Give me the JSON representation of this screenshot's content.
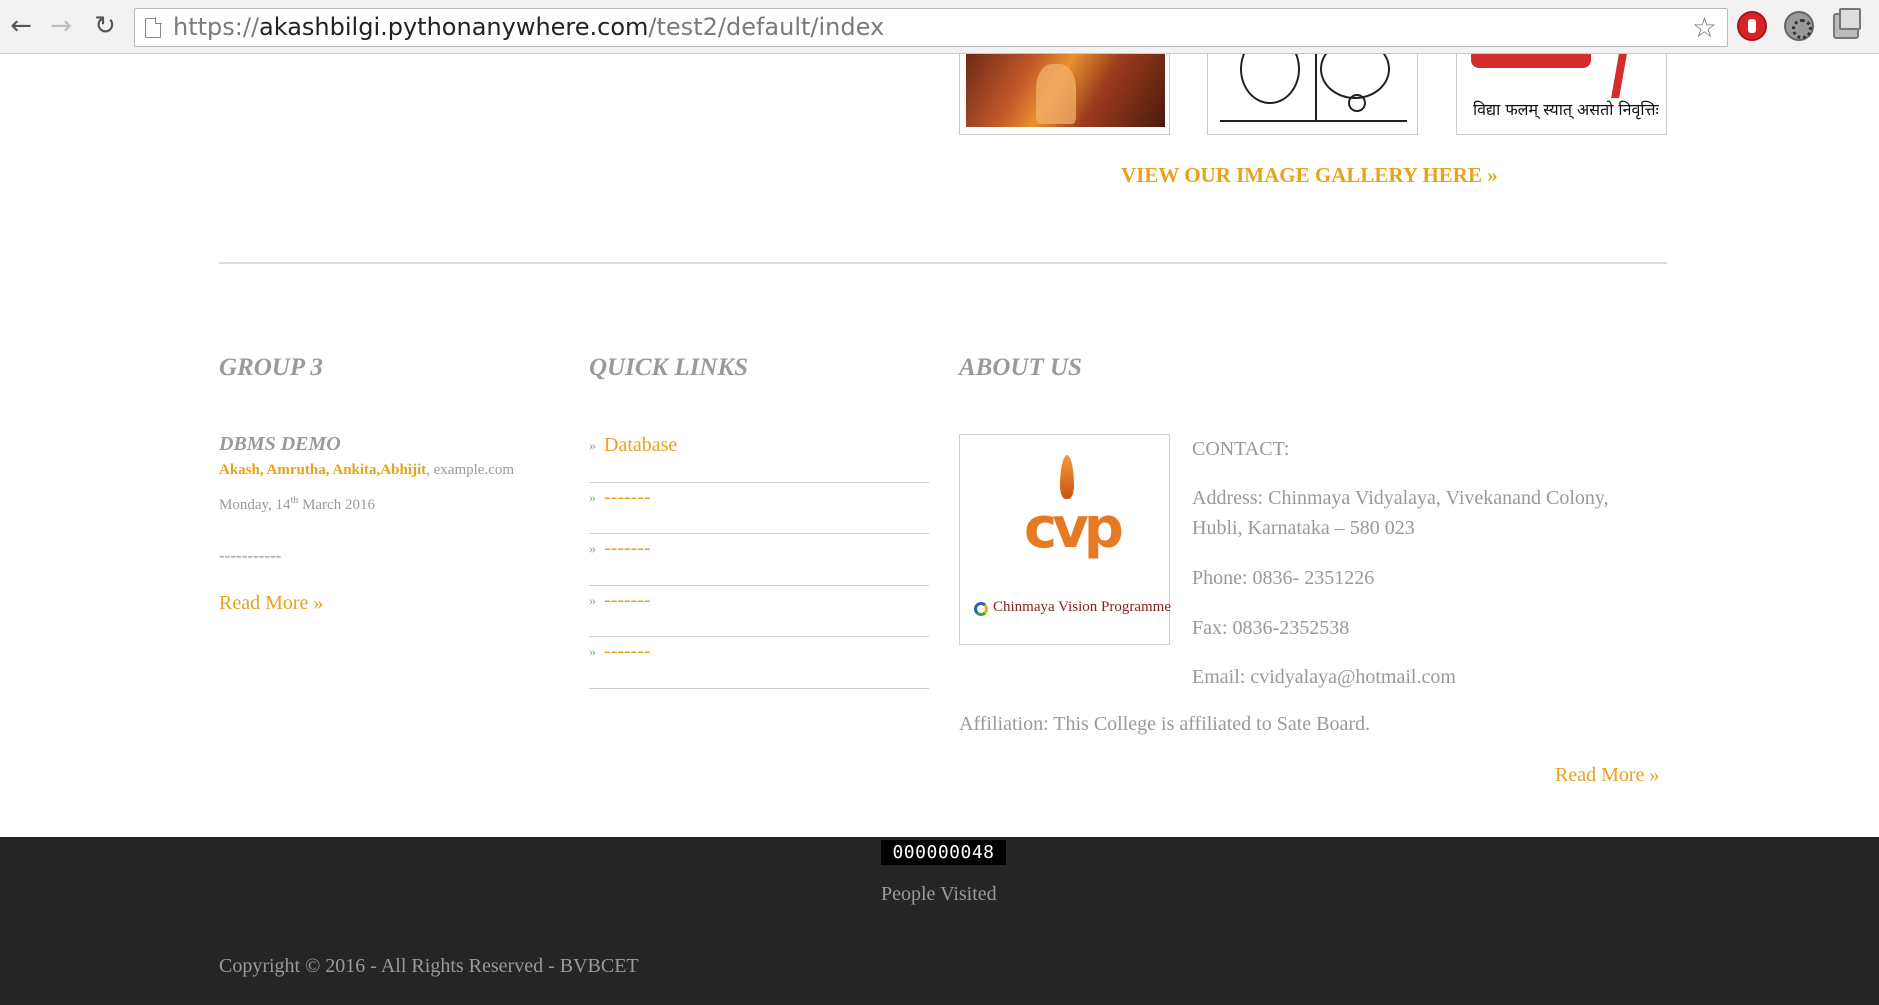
{
  "browser": {
    "url_scheme": "https://",
    "url_host": "akashbilgi.pythonanywhere.com",
    "url_path": "/test2/default/index"
  },
  "gallery": {
    "motto": "विद्या फलम् स्यात् असतो निवृत्तिः",
    "link_label": "VIEW OUR IMAGE GALLERY HERE »"
  },
  "group": {
    "heading": "GROUP 3",
    "post_title": "DBMS DEMO",
    "authors": "Akash, Amrutha, Ankita,Abhijit",
    "site": ", example.com",
    "date_prefix": "Monday, 14",
    "date_suffix": "th",
    "date_rest": " March 2016",
    "excerpt": "-----------",
    "read_more": "Read More »"
  },
  "quick_links": {
    "heading": "QUICK LINKS",
    "items": [
      {
        "label": "Database"
      },
      {
        "label": "-------"
      },
      {
        "label": "-------"
      },
      {
        "label": "-------"
      },
      {
        "label": "-------"
      }
    ]
  },
  "about": {
    "heading": "ABOUT US",
    "logo_caption": "Chinmaya Vision Programme",
    "logo_mark": "cvp",
    "contact_label": "CONTACT:",
    "address_line1": "Address: Chinmaya Vidyalaya, Vivekanand Colony,",
    "address_line2": "Hubli, Karnataka – 580 023",
    "phone": "Phone: 0836- 2351226",
    "fax": "Fax: 0836-2352538",
    "email": "Email: cvidyalaya@hotmail.com",
    "affiliation": "Affiliation: This College is affiliated to Sate Board.",
    "read_more": "Read More »"
  },
  "footer": {
    "counter": "000000048",
    "visited_label": "People Visited",
    "copyright": "Copyright © 2016 - All Rights Reserved - BVBCET"
  },
  "colors": {
    "accent": "#e8a21c",
    "text_muted": "#999999",
    "footer_bg": "#252525"
  }
}
